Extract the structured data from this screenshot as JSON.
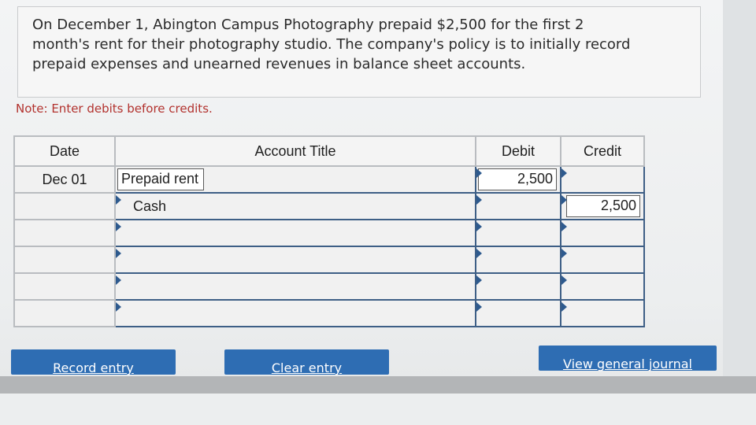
{
  "problem": {
    "text": "On December 1, Abington Campus Photography prepaid $2,500 for the first 2 month's rent for their photography studio. The company's policy is to initially record prepaid expenses and unearned revenues in balance sheet accounts."
  },
  "note": "Note: Enter debits before credits.",
  "journal": {
    "headers": {
      "date": "Date",
      "account_title": "Account Title",
      "debit": "Debit",
      "credit": "Credit"
    },
    "rows": [
      {
        "date": "Dec 01",
        "account": "Prepaid rent",
        "debit": "2,500",
        "credit": ""
      },
      {
        "date": "",
        "account": "Cash",
        "debit": "",
        "credit": "2,500"
      },
      {
        "date": "",
        "account": "",
        "debit": "",
        "credit": ""
      },
      {
        "date": "",
        "account": "",
        "debit": "",
        "credit": ""
      },
      {
        "date": "",
        "account": "",
        "debit": "",
        "credit": ""
      },
      {
        "date": "",
        "account": "",
        "debit": "",
        "credit": ""
      }
    ]
  },
  "buttons": {
    "record": "Record entry",
    "clear": "Clear entry",
    "view": "View general journal"
  },
  "colors": {
    "accent": "#2e6db3",
    "table_border": "#3e5f86",
    "note": "#b2322e"
  }
}
